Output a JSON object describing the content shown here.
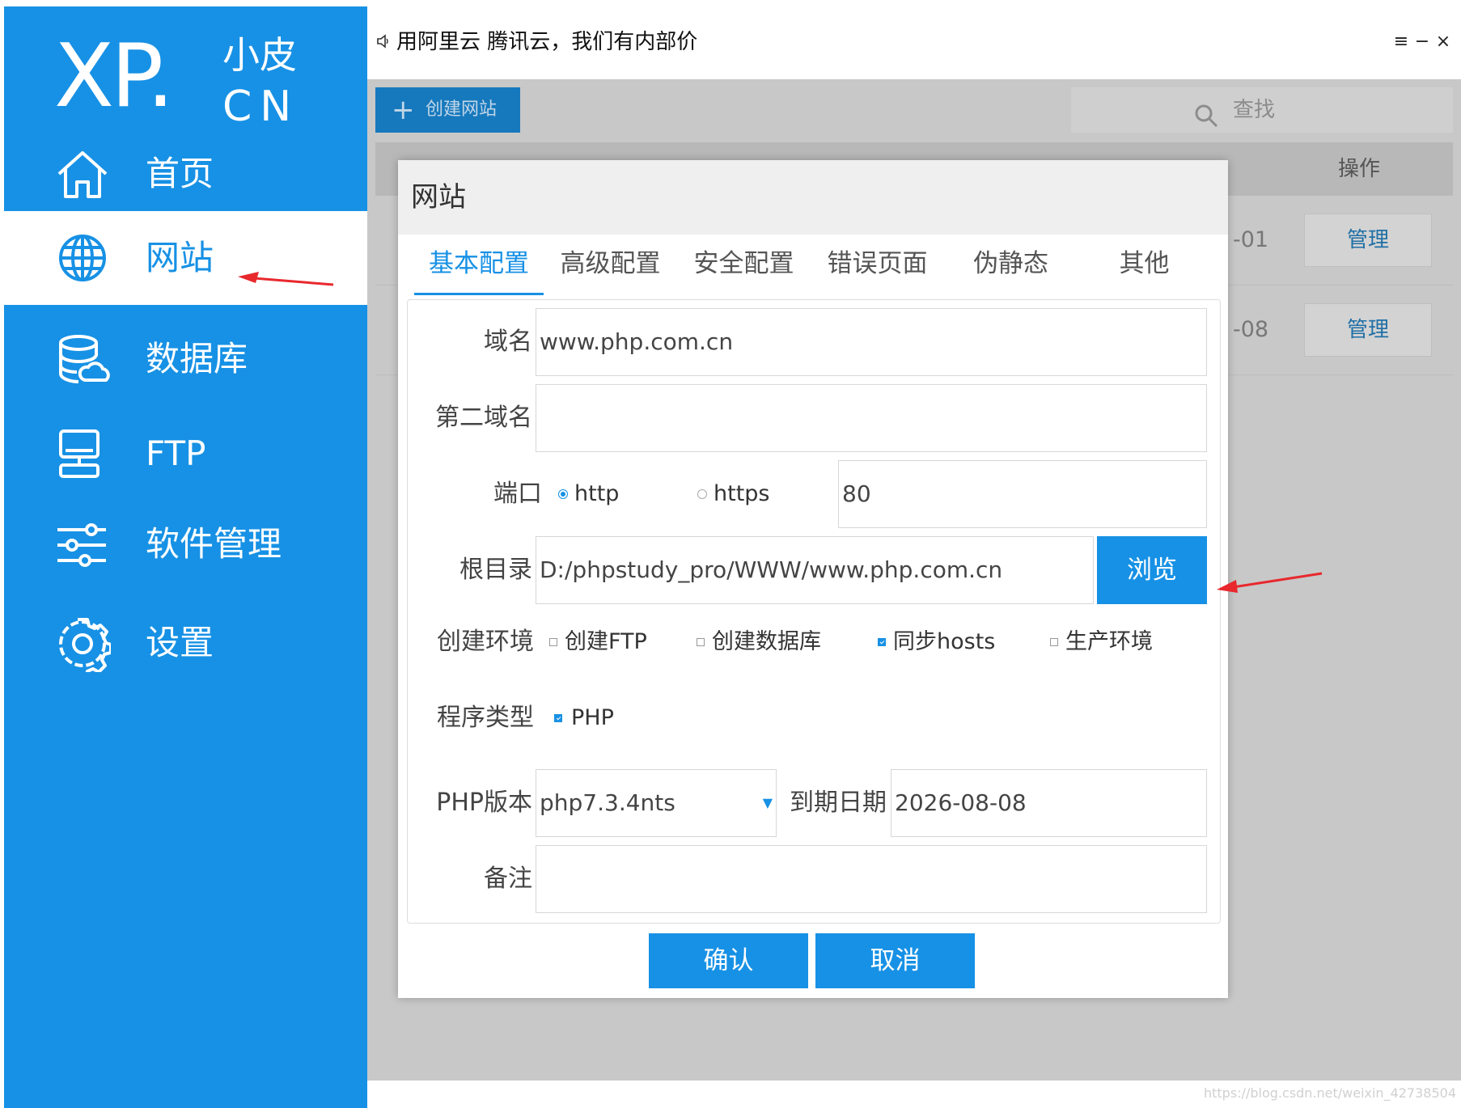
{
  "brand": {
    "logo_main": "XP.",
    "logo_cn_top": "小皮",
    "logo_cn_bottom": "CN"
  },
  "sidebar": {
    "items": [
      {
        "label": "首页",
        "icon": "home-icon"
      },
      {
        "label": "网站",
        "icon": "globe-icon",
        "active": true
      },
      {
        "label": "数据库",
        "icon": "database-icon"
      },
      {
        "label": "FTP",
        "icon": "ftp-server-icon"
      },
      {
        "label": "软件管理",
        "icon": "sliders-icon"
      },
      {
        "label": "设置",
        "icon": "gear-icon"
      }
    ]
  },
  "titlebar": {
    "ad_text": "用阿里云 腾讯云，我们有内部价",
    "menu_glyph": "≡",
    "minimize_glyph": "−",
    "close_glyph": "×"
  },
  "toolbar": {
    "create_label": "创建网站",
    "search_placeholder": "查找"
  },
  "table": {
    "header_action": "操作",
    "rows": [
      {
        "date_fragment": "-01",
        "action": "管理"
      },
      {
        "date_fragment": "-08",
        "action": "管理"
      }
    ]
  },
  "dialog": {
    "title": "网站",
    "tabs": [
      "基本配置",
      "高级配置",
      "安全配置",
      "错误页面",
      "伪静态",
      "其他"
    ],
    "active_tab": 0,
    "fields": {
      "domain_label": "域名",
      "domain_value": "www.php.com.cn",
      "second_domain_label": "第二域名",
      "second_domain_value": "",
      "port_label": "端口",
      "protocol_options": [
        {
          "label": "http",
          "selected": true
        },
        {
          "label": "https",
          "selected": false
        }
      ],
      "port_value": "80",
      "root_label": "根目录",
      "root_value": "D:/phpstudy_pro/WWW/www.php.com.cn",
      "browse_label": "浏览",
      "env_label": "创建环境",
      "env_options": [
        {
          "label": "创建FTP",
          "checked": false
        },
        {
          "label": "创建数据库",
          "checked": false
        },
        {
          "label": "同步hosts",
          "checked": true
        },
        {
          "label": "生产环境",
          "checked": false
        }
      ],
      "program_type_label": "程序类型",
      "program_type_option": {
        "label": "PHP",
        "checked": true
      },
      "php_version_label": "PHP版本",
      "php_version_value": "php7.3.4nts",
      "expire_label": "到期日期",
      "expire_value": "2026-08-08",
      "note_label": "备注",
      "note_value": ""
    },
    "confirm_label": "确认",
    "cancel_label": "取消"
  },
  "watermark": "https://blog.csdn.net/weixin_42738504",
  "colors": {
    "accent": "#1791e5",
    "annotation_arrow": "#e8282d",
    "dim_overlay": "#c8c8c8"
  }
}
